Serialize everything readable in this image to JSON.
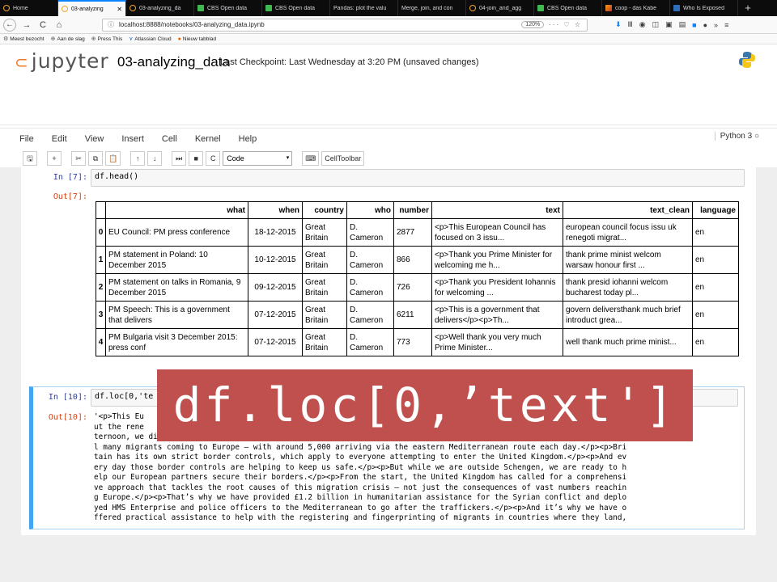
{
  "browser": {
    "tabs": [
      {
        "label": "Home",
        "icon": "jupyter-icon"
      },
      {
        "label": "03-analyzing",
        "icon": "jupyter-icon",
        "active": true
      },
      {
        "label": "03-analyzing_da",
        "icon": "jupyter-icon"
      },
      {
        "label": "CBS Open data",
        "icon": "cbs-icon"
      },
      {
        "label": "CBS Open data",
        "icon": "cbs-icon"
      },
      {
        "label": "Pandas: plot the valu",
        "icon": "none"
      },
      {
        "label": "Merge, join, and con",
        "icon": "none"
      },
      {
        "label": "04-join_and_agg",
        "icon": "jupyter-icon"
      },
      {
        "label": "CBS Open data",
        "icon": "cbs-icon"
      },
      {
        "label": "coop - das Kabe",
        "icon": "kabel-icon"
      },
      {
        "label": "Who Is Exposed",
        "icon": "exposed-icon"
      }
    ],
    "tab_close": "✕",
    "new_tab": "+",
    "nav": {
      "back": "←",
      "forward": "→",
      "reload": "C",
      "home": "⌂"
    },
    "url_info": "ⓘ",
    "url": "localhost:8888/notebooks/03-analyzing_data.ipynb",
    "zoom": "120%",
    "url_actions": "··· ♡ ☆",
    "bookmarks": [
      {
        "label": "Meest bezocht",
        "icon": "gear-icon"
      },
      {
        "label": "Aan de slag",
        "icon": "globe-icon"
      },
      {
        "label": "Press This",
        "icon": "globe-icon"
      },
      {
        "label": "Atlassian Cloud",
        "icon": "atlassian-icon"
      },
      {
        "label": "Nieuw tabblad",
        "icon": "firefox-icon"
      }
    ]
  },
  "jupyter": {
    "logo_text": "jupyter",
    "notebook_name": "03-analyzing_data",
    "checkpoint": "Last Checkpoint: Last Wednesday at 3:20 PM (unsaved changes)",
    "menu": [
      "File",
      "Edit",
      "View",
      "Insert",
      "Cell",
      "Kernel",
      "Help"
    ],
    "kernel": "Python 3",
    "cell_type": "Code",
    "celltoolbar": "CellToolbar",
    "colors": {
      "in_prompt": "#303f9f",
      "out_prompt": "#d84315",
      "selected_border": "#42a5f5",
      "banner": "#c0504d"
    }
  },
  "cells": {
    "cell7": {
      "in_prompt": "In [7]:",
      "code": "df.head()",
      "out_prompt": "Out[7]:"
    },
    "cell10": {
      "in_prompt": "In [10]:",
      "code": "df.loc[0,'te",
      "out_prompt": "Out[10]:",
      "output_lines": [
        "'<p>This Eu                                                                          ked abo",
        "ut the rene                                                                          rday af",
        "ternoon, we discussed the ongoing migration crisis facing Europe.</p><p>Even with the onset of winter, there are stil",
        "l many migrants coming to Europe – with around 5,000 arriving via the eastern Mediterranean route each day.</p><p>Bri",
        "tain has its own strict border controls, which apply to everyone attempting to enter the United Kingdom.</p><p>And ev",
        "ery day those border controls are helping to keep us safe.</p><p>But while we are outside Schengen, we are ready to h",
        "elp our European partners secure their borders.</p><p>From the start, the United Kingdom has called for a comprehensi",
        "ve approach that tackles the root causes of this migration crisis – not just the consequences of vast numbers reachin",
        "g Europe.</p><p>That’s why we have provided £1.2 billion in humanitarian assistance for the Syrian conflict and deplo",
        "yed HMS Enterprise and police officers to the Mediterranean to go after the traffickers.</p><p>And it’s why we have o",
        "ffered practical assistance to help with the registering and fingerprinting of migrants in countries where they land,"
      ]
    }
  },
  "dataframe": {
    "columns": [
      "what",
      "when",
      "country",
      "who",
      "number",
      "text",
      "text_clean",
      "language"
    ],
    "rows": [
      {
        "idx": "0",
        "what": "EU Council: PM press conference",
        "when": "18-12-2015",
        "country": "Great Britain",
        "who": "D. Cameron",
        "number": "2877",
        "text": "<p>This European Council has focused on 3 issu...",
        "text_clean": "european council focus issu uk renegoti migrat...",
        "language": "en"
      },
      {
        "idx": "1",
        "what": "PM statement in Poland: 10 December 2015",
        "when": "10-12-2015",
        "country": "Great Britain",
        "who": "D. Cameron",
        "number": "866",
        "text": "<p>Thank you Prime Minister for welcoming me h...",
        "text_clean": "thank prime minist welcom warsaw honour first ...",
        "language": "en"
      },
      {
        "idx": "2",
        "what": "PM statement on talks in Romania, 9 December 2015",
        "when": "09-12-2015",
        "country": "Great Britain",
        "who": "D. Cameron",
        "number": "726",
        "text": "<p>Thank you President Iohannis for welcoming ...",
        "text_clean": "thank presid iohanni welcom bucharest today pl...",
        "language": "en"
      },
      {
        "idx": "3",
        "what": "PM Speech: This is a government that delivers",
        "when": "07-12-2015",
        "country": "Great Britain",
        "who": "D. Cameron",
        "number": "6211",
        "text": "<p>This is a government that delivers</p><p>Th...",
        "text_clean": "govern deliversthank much brief introduct grea...",
        "language": "en"
      },
      {
        "idx": "4",
        "what": "PM Bulgaria visit 3 December 2015: press conf",
        "when": "07-12-2015",
        "country": "Great Britain",
        "who": "D. Cameron",
        "number": "773",
        "text": "<p>Well thank you very much Prime Minister...",
        "text_clean": "well thank much prime minist...",
        "language": "en"
      }
    ]
  },
  "overlay": {
    "text": "df.loc[0,’text']"
  }
}
